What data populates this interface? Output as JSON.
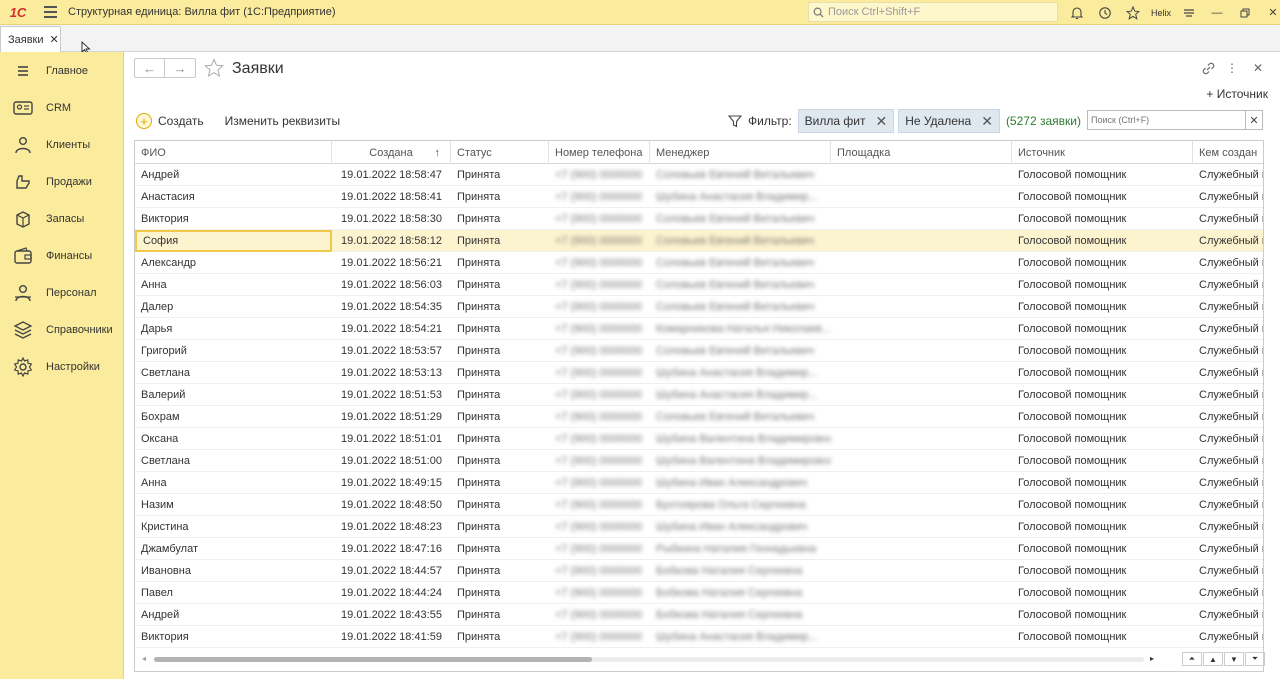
{
  "window": {
    "logo": "1С",
    "title": "Структурная единица: Вилла фит  (1С:Предприятие)",
    "search_placeholder": "Поиск Ctrl+Shift+F",
    "username": "Helix"
  },
  "tabs": [
    {
      "label": "Заявки"
    }
  ],
  "sidebar": {
    "items": [
      {
        "label": "Главное",
        "icon": "menu-lines-icon"
      },
      {
        "label": "CRM",
        "icon": "crm-card-icon"
      },
      {
        "label": "Клиенты",
        "icon": "clients-icon"
      },
      {
        "label": "Продажи",
        "icon": "sales-icon"
      },
      {
        "label": "Запасы",
        "icon": "stock-icon"
      },
      {
        "label": "Финансы",
        "icon": "wallet-icon"
      },
      {
        "label": "Персонал",
        "icon": "staff-icon"
      },
      {
        "label": "Справочники",
        "icon": "catalogs-icon"
      },
      {
        "label": "Настройки",
        "icon": "settings-gear-icon"
      }
    ]
  },
  "page": {
    "title": "Заявки",
    "add_source": "+ Источник",
    "create": "Создать",
    "edit_props": "Изменить реквизиты",
    "filter_label": "Фильтр:",
    "chips": [
      "Вилла фит",
      "Не Удалена"
    ],
    "count": "(5272 заявки)",
    "search_placeholder": "Поиск (Ctrl+F)"
  },
  "table": {
    "columns": [
      "ФИО",
      "Создана",
      "Статус",
      "Номер телефона",
      "Менеджер",
      "Площадка",
      "Источник",
      "Кем создан"
    ],
    "sort_indicator": "↑",
    "rows": [
      {
        "name": "Андрей",
        "created": "19.01.2022 18:58:47",
        "status": "Принята",
        "phone": "+7 (900) 0000000",
        "manager": "Соловьев Евгений Витальевич",
        "source": "Голосовой помощник",
        "creator": "Служебный по"
      },
      {
        "name": "Анастасия",
        "created": "19.01.2022 18:58:41",
        "status": "Принята",
        "phone": "+7 (900) 0000000",
        "manager": "Шубина Анастасия Владимир...",
        "source": "Голосовой помощник",
        "creator": "Служебный по"
      },
      {
        "name": "Виктория",
        "created": "19.01.2022 18:58:30",
        "status": "Принята",
        "phone": "+7 (900) 0000000",
        "manager": "Соловьев Евгений Витальевич",
        "source": "Голосовой помощник",
        "creator": "Служебный по"
      },
      {
        "name": "София",
        "created": "19.01.2022 18:58:12",
        "status": "Принята",
        "phone": "+7 (900) 0000000",
        "manager": "Соловьев Евгений Витальевич",
        "source": "Голосовой помощник",
        "creator": "Служебный по"
      },
      {
        "name": "Александр",
        "created": "19.01.2022 18:56:21",
        "status": "Принята",
        "phone": "+7 (900) 0000000",
        "manager": "Соловьев Евгений Витальевич",
        "source": "Голосовой помощник",
        "creator": "Служебный по"
      },
      {
        "name": "Анна",
        "created": "19.01.2022 18:56:03",
        "status": "Принята",
        "phone": "+7 (900) 0000000",
        "manager": "Соловьев Евгений Витальевич",
        "source": "Голосовой помощник",
        "creator": "Служебный по"
      },
      {
        "name": "Далер",
        "created": "19.01.2022 18:54:35",
        "status": "Принята",
        "phone": "+7 (900) 0000000",
        "manager": "Соловьев Евгений Витальевич",
        "source": "Голосовой помощник",
        "creator": "Служебный по"
      },
      {
        "name": "Дарья",
        "created": "19.01.2022 18:54:21",
        "status": "Принята",
        "phone": "+7 (900) 0000000",
        "manager": "Комарникова Наталья Николаев...",
        "source": "Голосовой помощник",
        "creator": "Служебный по"
      },
      {
        "name": "Григорий",
        "created": "19.01.2022 18:53:57",
        "status": "Принята",
        "phone": "+7 (900) 0000000",
        "manager": "Соловьев Евгений Витальевич",
        "source": "Голосовой помощник",
        "creator": "Служебный по"
      },
      {
        "name": "Светлана",
        "created": "19.01.2022 18:53:13",
        "status": "Принята",
        "phone": "+7 (900) 0000000",
        "manager": "Шубина Анастасия Владимир...",
        "source": "Голосовой помощник",
        "creator": "Служебный по"
      },
      {
        "name": "Валерий",
        "created": "19.01.2022 18:51:53",
        "status": "Принята",
        "phone": "+7 (900) 0000000",
        "manager": "Шубина Анастасия Владимир...",
        "source": "Голосовой помощник",
        "creator": "Служебный по"
      },
      {
        "name": "Бохрам",
        "created": "19.01.2022 18:51:29",
        "status": "Принята",
        "phone": "+7 (900) 0000000",
        "manager": "Соловьев Евгений Витальевич",
        "source": "Голосовой помощник",
        "creator": "Служебный по"
      },
      {
        "name": "Оксана",
        "created": "19.01.2022 18:51:01",
        "status": "Принята",
        "phone": "+7 (900) 0000000",
        "manager": "Шубина Валентина Владимировна",
        "source": "Голосовой помощник",
        "creator": "Служебный по"
      },
      {
        "name": "Светлана",
        "created": "19.01.2022 18:51:00",
        "status": "Принята",
        "phone": "+7 (900) 0000000",
        "manager": "Шубина Валентина Владимировна",
        "source": "Голосовой помощник",
        "creator": "Служебный по"
      },
      {
        "name": "Анна",
        "created": "19.01.2022 18:49:15",
        "status": "Принята",
        "phone": "+7 (900) 0000000",
        "manager": "Шубина Иван Александрович",
        "source": "Голосовой помощник",
        "creator": "Служебный по"
      },
      {
        "name": "Назим",
        "created": "19.01.2022 18:48:50",
        "status": "Принята",
        "phone": "+7 (900) 0000000",
        "manager": "Бухтоярова Ольга Сергеевна",
        "source": "Голосовой помощник",
        "creator": "Служебный по"
      },
      {
        "name": "Кристина",
        "created": "19.01.2022 18:48:23",
        "status": "Принята",
        "phone": "+7 (900) 0000000",
        "manager": "Шубина Иван Александрович",
        "source": "Голосовой помощник",
        "creator": "Служебный по"
      },
      {
        "name": "Джамбулат",
        "created": "19.01.2022 18:47:16",
        "status": "Принята",
        "phone": "+7 (900) 0000000",
        "manager": "Рыбкина Наталия Геннадьевна",
        "source": "Голосовой помощник",
        "creator": "Служебный по"
      },
      {
        "name": "Ивановна",
        "created": "19.01.2022 18:44:57",
        "status": "Принята",
        "phone": "+7 (900) 0000000",
        "manager": "Бобкова Наталия Сергеевна",
        "source": "Голосовой помощник",
        "creator": "Служебный по"
      },
      {
        "name": "Павел",
        "created": "19.01.2022 18:44:24",
        "status": "Принята",
        "phone": "+7 (900) 0000000",
        "manager": "Бобкова Наталия Сергеевна",
        "source": "Голосовой помощник",
        "creator": "Служебный по"
      },
      {
        "name": "Андрей",
        "created": "19.01.2022 18:43:55",
        "status": "Принята",
        "phone": "+7 (900) 0000000",
        "manager": "Бобкова Наталия Сергеевна",
        "source": "Голосовой помощник",
        "creator": "Служебный по"
      },
      {
        "name": "Виктория",
        "created": "19.01.2022 18:41:59",
        "status": "Принята",
        "phone": "+7 (900) 0000000",
        "manager": "Шубина Анастасия Владимир...",
        "source": "Голосовой помощник",
        "creator": "Служебный по"
      }
    ],
    "selected_row": 3
  },
  "colors": {
    "accent_yellow": "#fbeb9c",
    "selection": "#fcf3cf",
    "count_green": "#2e7d32"
  }
}
